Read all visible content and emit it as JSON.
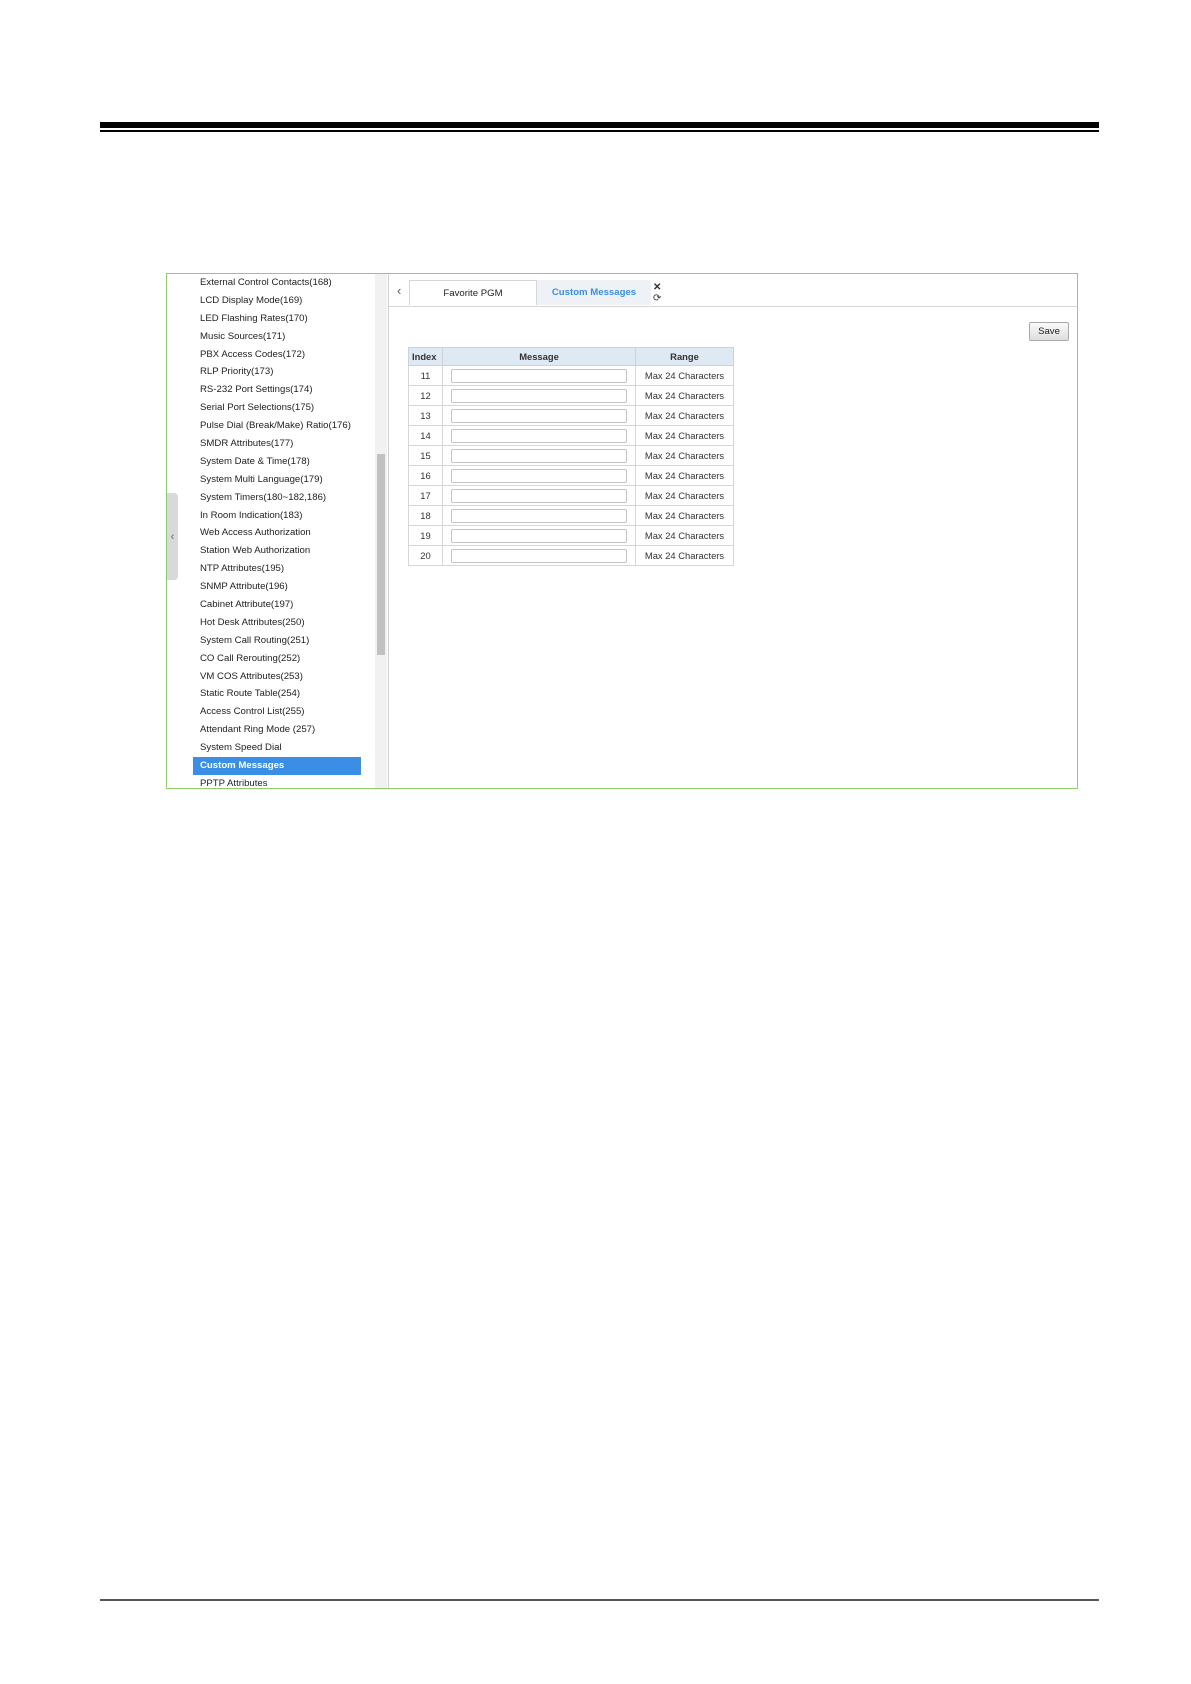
{
  "sidebar": {
    "collapse_glyph": "‹",
    "items": [
      "External Control Contacts(168)",
      "LCD Display Mode(169)",
      "LED Flashing Rates(170)",
      "Music Sources(171)",
      "PBX Access Codes(172)",
      "RLP Priority(173)",
      "RS-232 Port Settings(174)",
      "Serial Port Selections(175)",
      "Pulse Dial (Break/Make) Ratio(176)",
      "SMDR Attributes(177)",
      "System Date & Time(178)",
      "System Multi Language(179)",
      "System Timers(180~182,186)",
      "In Room Indication(183)",
      "Web Access Authorization",
      "Station Web Authorization",
      "NTP Attributes(195)",
      "SNMP Attribute(196)",
      "Cabinet Attribute(197)",
      "Hot Desk Attributes(250)",
      "System Call Routing(251)",
      "CO Call Rerouting(252)",
      "VM COS Attributes(253)",
      "Static Route Table(254)",
      "Access Control List(255)",
      "Attendant Ring Mode (257)",
      "System Speed Dial",
      "Custom Messages",
      "PPTP Attributes"
    ],
    "active_item": "Custom Messages"
  },
  "tabs": {
    "prev_icon": "‹",
    "items": [
      {
        "label": "Favorite PGM",
        "active": false
      },
      {
        "label": "Custom Messages",
        "active": true
      }
    ],
    "close_icon": "✕",
    "refresh_icon": "⟳",
    "strip_close_icon": "✕",
    "strip_menu_icon": "⌄",
    "next_icon": "›"
  },
  "toolbar": {
    "save_label": "Save"
  },
  "table": {
    "headers": {
      "index": "Index",
      "message": "Message",
      "range": "Range"
    },
    "rows": [
      {
        "index": "11",
        "message": "",
        "range": "Max 24 Characters"
      },
      {
        "index": "12",
        "message": "",
        "range": "Max 24 Characters"
      },
      {
        "index": "13",
        "message": "",
        "range": "Max 24 Characters"
      },
      {
        "index": "14",
        "message": "",
        "range": "Max 24 Characters"
      },
      {
        "index": "15",
        "message": "",
        "range": "Max 24 Characters"
      },
      {
        "index": "16",
        "message": "",
        "range": "Max 24 Characters"
      },
      {
        "index": "17",
        "message": "",
        "range": "Max 24 Characters"
      },
      {
        "index": "18",
        "message": "",
        "range": "Max 24 Characters"
      },
      {
        "index": "19",
        "message": "",
        "range": "Max 24 Characters"
      },
      {
        "index": "20",
        "message": "",
        "range": "Max 24 Characters"
      }
    ]
  },
  "colors": {
    "accent": "#3a8ee6",
    "frame_border": "#8fce6b",
    "table_header_bg": "#dfe9f3"
  }
}
